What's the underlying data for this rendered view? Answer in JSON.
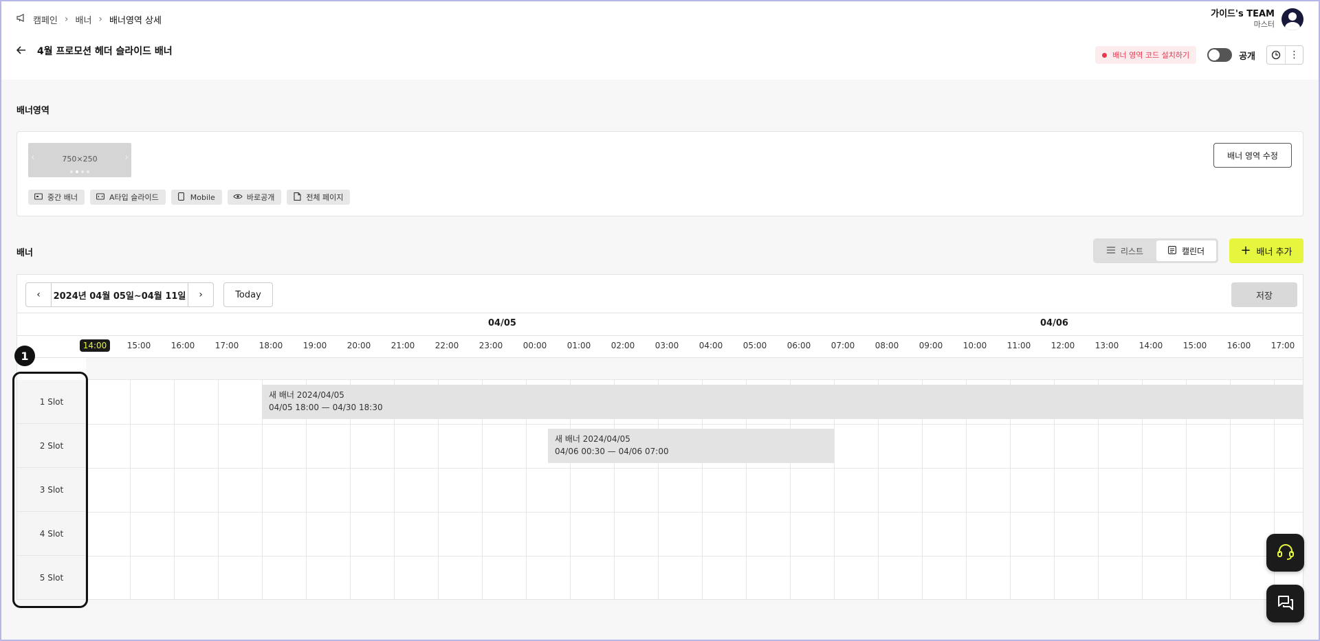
{
  "breadcrumb": {
    "items": [
      "캠페인",
      "배너",
      "배너영역 상세"
    ]
  },
  "user": {
    "team": "가이드's TEAM",
    "role": "마스터"
  },
  "page": {
    "title": "4월 프로모션 헤더 슬라이드 배너"
  },
  "actions": {
    "code_install": "배너 영역 코드 설치하기",
    "public_label": "공개",
    "public_on": false
  },
  "banner_area": {
    "section_label": "배너영역",
    "thumb_size": "750×250",
    "chips": [
      {
        "icon": "banner-icon",
        "label": "중간 배너"
      },
      {
        "icon": "slide-icon",
        "label": "A타입 슬라이드"
      },
      {
        "icon": "mobile-icon",
        "label": "Mobile"
      },
      {
        "icon": "eye-icon",
        "label": "바로공개"
      },
      {
        "icon": "page-icon",
        "label": "전체 페이지"
      }
    ],
    "edit_button": "배너 영역 수정"
  },
  "banners": {
    "section_label": "배너",
    "view_list": "리스트",
    "view_calendar": "캘린더",
    "active_view": "캘린더",
    "add_button": "배너 추가"
  },
  "calendar": {
    "range": "2024년 04월 05일~04월 11일",
    "today": "Today",
    "save": "저장",
    "dates": [
      "04/05",
      "04/06"
    ],
    "hours": [
      "14:00",
      "15:00",
      "16:00",
      "17:00",
      "18:00",
      "19:00",
      "20:00",
      "21:00",
      "22:00",
      "23:00",
      "00:00",
      "01:00",
      "02:00",
      "03:00",
      "04:00",
      "05:00",
      "06:00",
      "07:00",
      "08:00",
      "09:00",
      "10:00",
      "11:00",
      "12:00",
      "13:00",
      "14:00",
      "15:00",
      "16:00",
      "17:00"
    ],
    "current_hour": "14:00",
    "slots": [
      "1 Slot",
      "2 Slot",
      "3 Slot",
      "4 Slot",
      "5 Slot"
    ],
    "events": [
      {
        "slot": 1,
        "name": "새 배너 2024/04/05",
        "period": "04/05 18:00 — 04/30 18:30"
      },
      {
        "slot": 2,
        "name": "새 배너 2024/04/05",
        "period": "04/06 00:30 — 04/06 07:00"
      }
    ]
  },
  "annotation": {
    "marker": "1"
  },
  "colors": {
    "accent": "#e6f53e",
    "danger": "#e8364d",
    "dark": "#1b1b1b"
  }
}
